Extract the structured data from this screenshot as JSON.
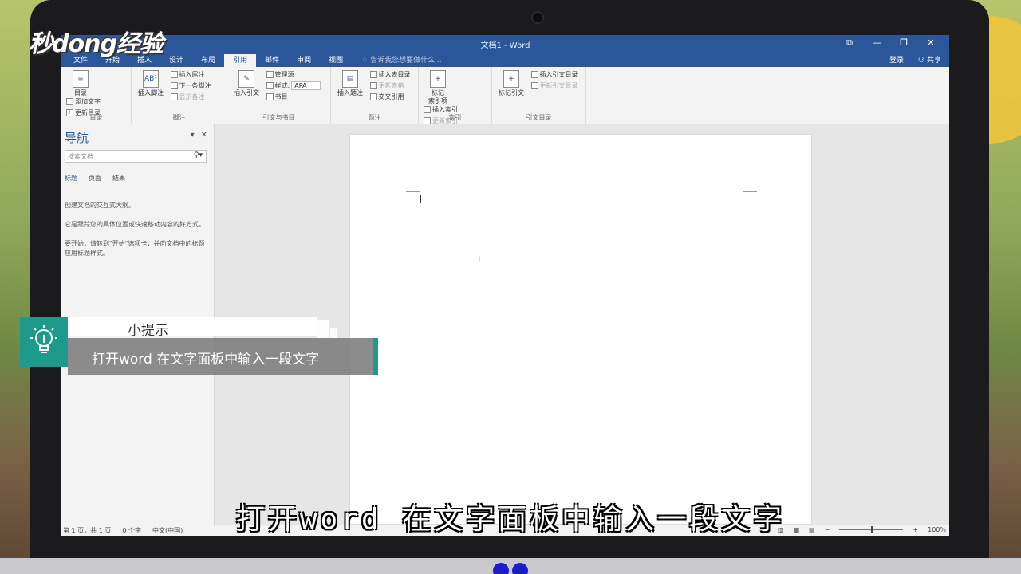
{
  "logo": {
    "text": "秒dong经验"
  },
  "window": {
    "title": "文档1 - Word",
    "buttons": {
      "ribbon_display": "⧉",
      "minimize": "—",
      "restore": "❐",
      "close": "✕"
    }
  },
  "tabs": [
    "文件",
    "开始",
    "插入",
    "设计",
    "布局",
    "引用",
    "邮件",
    "审阅",
    "视图"
  ],
  "active_tab": "引用",
  "tell_me": "告诉我您想要做什么...",
  "account": {
    "signin": "登录",
    "share": "共享"
  },
  "ribbon": {
    "toc": {
      "label": "目录",
      "btn": "目录",
      "add_text": "添加文字",
      "update": "更新目录"
    },
    "footnotes": {
      "label": "脚注",
      "insert_footnote": "插入脚注",
      "insert_endnote": "插入尾注",
      "next_footnote": "下一条脚注",
      "show_notes": "显示备注"
    },
    "citations": {
      "label": "引文与书目",
      "insert_citation": "插入引文",
      "manage_sources": "管理源",
      "style_label": "样式:",
      "style_value": "APA",
      "bibliography": "书目"
    },
    "captions": {
      "label": "题注",
      "insert_caption": "插入题注",
      "insert_tof": "插入表目录",
      "update_table": "更新表格",
      "cross_ref": "交叉引用"
    },
    "index": {
      "label": "索引",
      "mark_entry": "标记索引项",
      "mark_line1": "标记",
      "mark_line2": "索引项",
      "insert_index": "插入索引",
      "update_index": "更新索引"
    },
    "toa": {
      "label": "引文目录",
      "mark_citation": "标记引文",
      "insert_toa": "插入引文目录",
      "update_toa": "更新引文目录"
    }
  },
  "nav": {
    "title": "导航",
    "search_placeholder": "搜索文档",
    "tabs": [
      "标题",
      "页面",
      "结果"
    ],
    "para1": "创建文档的交互式大纲。",
    "para2": "它是跟踪您的具体位置或快速移动内容的好方式。",
    "para3": "要开始，请转到\"开始\"选项卡，并向文档中的标题应用标题样式。"
  },
  "status": {
    "page": "第 1 页，共 1 页",
    "words": "0 个字",
    "lang": "中文(中国)",
    "zoom": "100%"
  },
  "tip": {
    "heading": "小提示",
    "body": "打开word 在文字面板中输入一段文字"
  },
  "subtitle": "打开word 在文字面板中输入一段文字",
  "colors": {
    "word_blue": "#2b579a",
    "tip_teal": "#1d9a8c"
  }
}
